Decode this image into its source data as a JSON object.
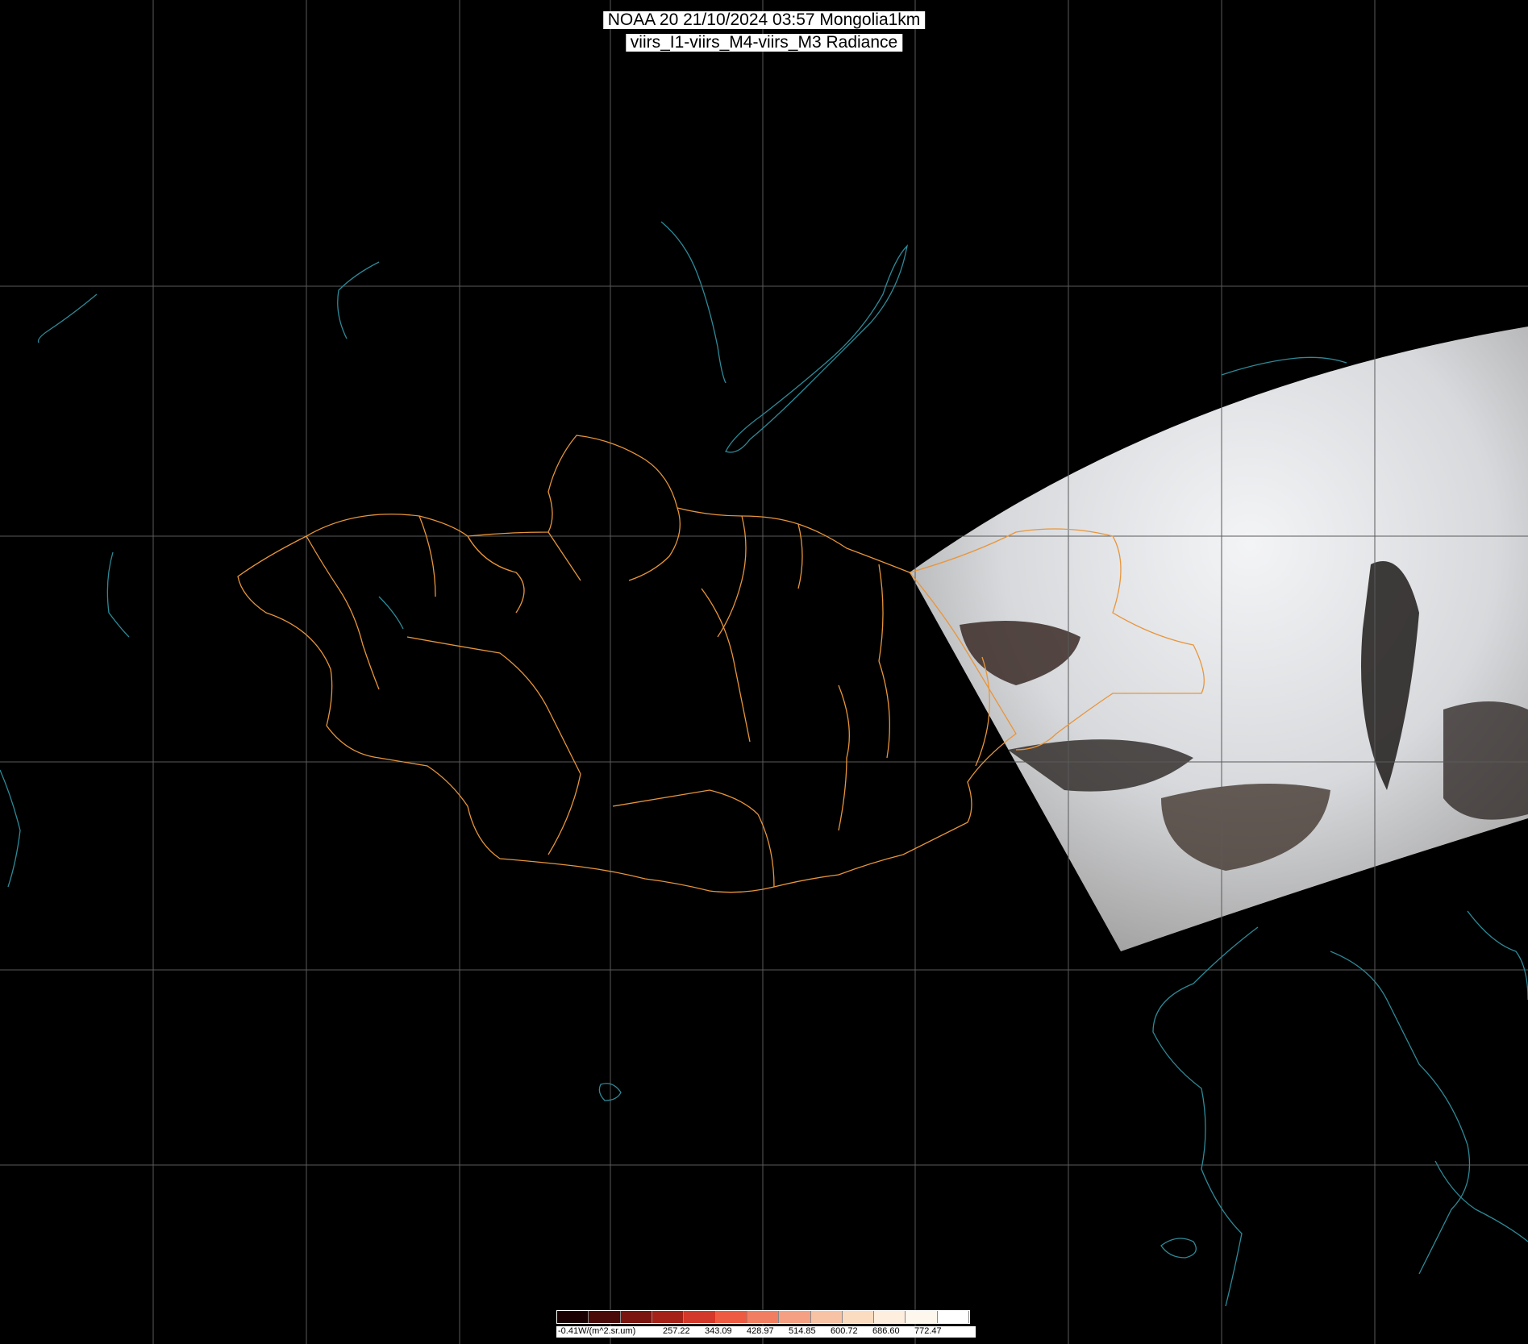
{
  "title": {
    "line1": "NOAA 20 21/10/2024 03:57 Mongolia1km",
    "line2": "viirs_I1-viirs_M4-viirs_M3 Radiance"
  },
  "colorbar": {
    "unit_label": "-0.41W/(m^2.sr.um)",
    "tick_labels": [
      "257.22",
      "343.09",
      "428.97",
      "514.85",
      "600.72",
      "686.60",
      "772.47"
    ],
    "colors": [
      "#1a0000",
      "#4a0a08",
      "#7a1510",
      "#a52218",
      "#d2392a",
      "#ec5b42",
      "#f27e62",
      "#f5a083",
      "#f8c2a4",
      "#fbdcc0",
      "#fdeede",
      "#fdf7ee",
      "#ffffff"
    ]
  },
  "colors": {
    "background": "#000000",
    "grid": "#5a5a5a",
    "border": "#e8953a",
    "water": "#2d8a98",
    "cloud": "#e9ecef"
  }
}
